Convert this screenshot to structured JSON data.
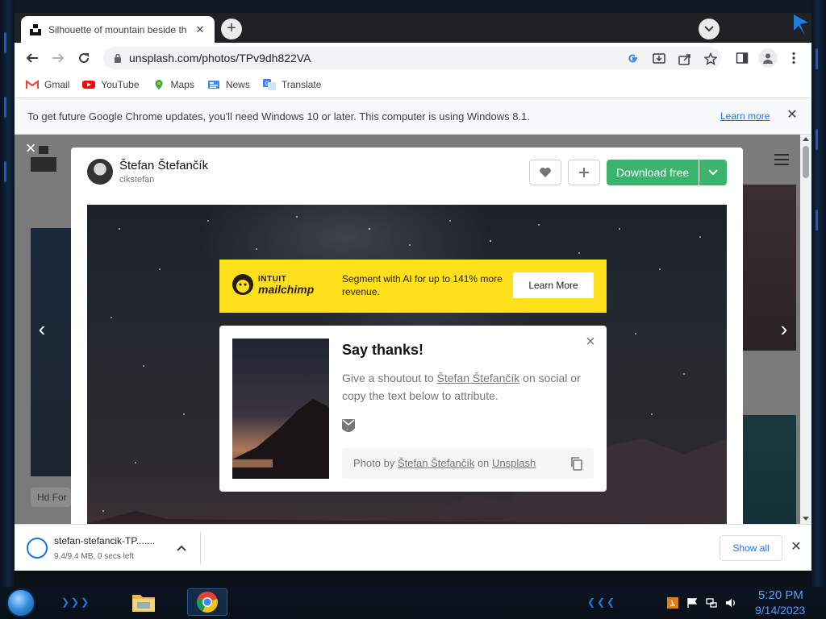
{
  "browser": {
    "tab_title": "Silhouette of mountain beside th",
    "tab_close": "✕",
    "new_tab": "+",
    "url": "unsplash.com/photos/TPv9dh822VA",
    "bookmarks": [
      {
        "label": "Gmail",
        "icon": "gmail-icon"
      },
      {
        "label": "YouTube",
        "icon": "youtube-icon"
      },
      {
        "label": "Maps",
        "icon": "maps-icon"
      },
      {
        "label": "News",
        "icon": "news-icon"
      },
      {
        "label": "Translate",
        "icon": "translate-icon"
      }
    ],
    "infobar": {
      "message": "To get future Google Chrome updates, you'll need Windows 10 or later. This computer is using Windows 8.1.",
      "learn_more": "Learn more",
      "close": "✕"
    }
  },
  "page": {
    "bg_chip": "Hd For",
    "modal": {
      "author_name": "Štefan Štefančík",
      "author_handle": "cikstefan",
      "download_label": "Download free",
      "ad": {
        "brand_top": "INTUIT",
        "brand": "mailchimp",
        "text": "Segment with AI for up to 141% more revenue.",
        "button": "Learn More"
      },
      "say_thanks": {
        "title": "Say thanks!",
        "text_pre": "Give a shoutout to ",
        "author_link": "Štefan Štefančík",
        "text_post": " on social or copy the text below to attribute.",
        "credit_pre": "Photo by ",
        "credit_author": "Štefan Štefančík",
        "credit_mid": " on ",
        "credit_site": "Unsplash"
      }
    }
  },
  "download_bar": {
    "filename": "stefan-stefancik-TP.......",
    "status": "9.4/9.4 MB, 0 secs left",
    "show_all": "Show all",
    "close": "✕"
  },
  "taskbar": {
    "time": "5:20 PM",
    "date": "9/14/2023"
  },
  "colors": {
    "download_green": "#3cb46e",
    "mailchimp_yellow": "#ffe01b",
    "chrome_blue": "#1a73e8"
  }
}
